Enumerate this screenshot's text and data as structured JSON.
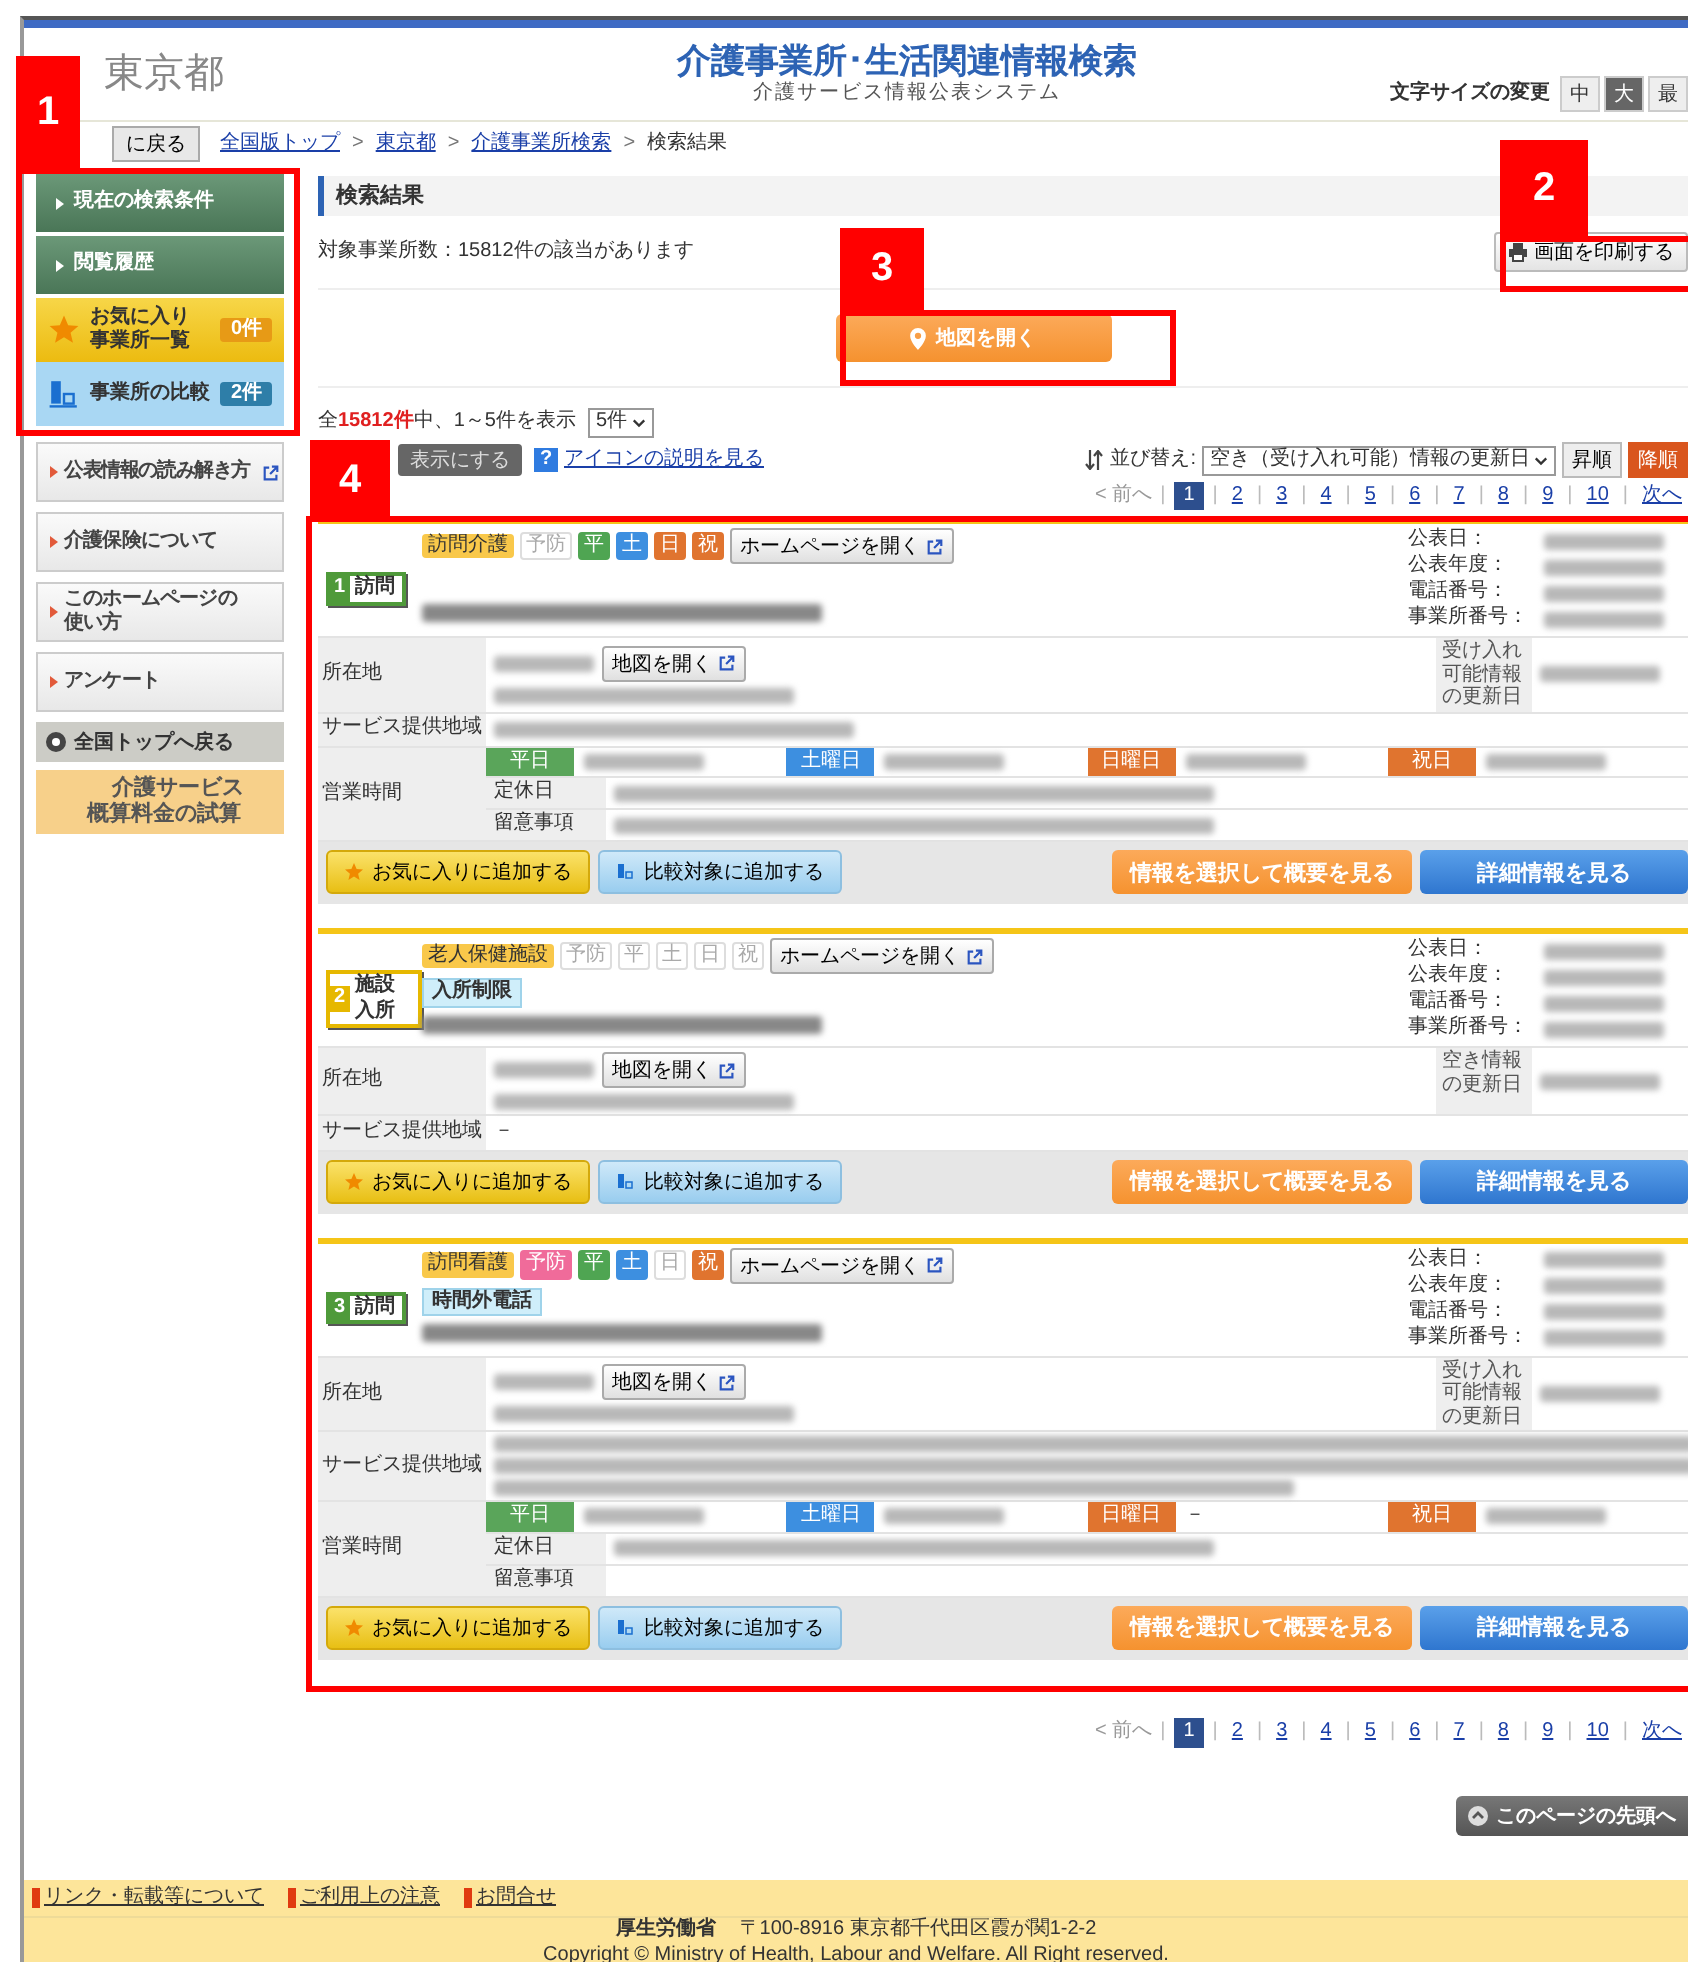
{
  "annotations": [
    {
      "label": "1"
    },
    {
      "label": "2"
    },
    {
      "label": "3"
    },
    {
      "label": "4"
    }
  ],
  "header": {
    "logo": "東京都",
    "title": "介護事業所･生活関連情報検索",
    "subtitle": "介護サービス情報公表システム",
    "font_size_label": "文字サイズの変更",
    "font_sizes": [
      {
        "label": "中",
        "selected": false
      },
      {
        "label": "大",
        "selected": true
      },
      {
        "label": "最",
        "selected": false
      }
    ]
  },
  "breadcrumb": {
    "back_button": "に戻る",
    "separator": ">",
    "links": [
      "全国版トップ",
      "東京都",
      "介護事業所検索"
    ],
    "current": "検索結果"
  },
  "sidebar": {
    "menu": [
      {
        "kind": "green",
        "label": "現在の検索条件"
      },
      {
        "kind": "green",
        "label": "閲覧履歴"
      },
      {
        "kind": "favorite",
        "label": "お気に入り事業所一覧",
        "count": "0件"
      },
      {
        "kind": "compare",
        "label": "事業所の比較",
        "count": "2件"
      }
    ],
    "links": [
      {
        "label": "公表情報の読み解き方",
        "external": true
      },
      {
        "label": "介護保険について",
        "external": false
      },
      {
        "label": "このホームページの使い方",
        "external": false
      },
      {
        "label": "アンケート",
        "external": false
      }
    ],
    "back_button": "全国トップへ戻る",
    "estimate_button": "介護サービス概算料金の試算"
  },
  "results": {
    "heading": "検索結果",
    "summary": "対象事業所数：15812件の該当があります",
    "print_button": "画面を印刷する",
    "map_button": "地図を開く",
    "count_prefix": "全",
    "count_total": "15812件",
    "count_suffix": "中、1～5件を表示",
    "per_page": "5件",
    "toggle_button": "表示にする",
    "help_icon": "?",
    "help_link": "アイコンの説明を見る",
    "sort_label": "並び替え:",
    "sort_value": "空き（受け入れ可能）情報の更新日",
    "sort_buttons": [
      {
        "label": "昇順",
        "selected": false
      },
      {
        "label": "降順",
        "selected": true
      }
    ]
  },
  "pager_top": {
    "prev": "< 前へ",
    "separator": "|",
    "pages": [
      {
        "label": "1",
        "selected": true
      },
      {
        "label": "2",
        "selected": false
      },
      {
        "label": "3",
        "selected": false
      },
      {
        "label": "4",
        "selected": false
      },
      {
        "label": "5",
        "selected": false
      },
      {
        "label": "6",
        "selected": false
      },
      {
        "label": "7",
        "selected": false
      },
      {
        "label": "8",
        "selected": false
      },
      {
        "label": "9",
        "selected": false
      },
      {
        "label": "10",
        "selected": false
      }
    ],
    "next": "次へ"
  },
  "cards": [
    {
      "kind": "visit",
      "number": "1",
      "category": "訪問",
      "service": "訪問介護",
      "tags": [
        {
          "label": "予防",
          "on": false
        },
        {
          "label": "平",
          "on": true,
          "color": "#4fa552"
        },
        {
          "label": "土",
          "on": true,
          "color": "#3d8fe0"
        },
        {
          "label": "日",
          "on": true,
          "color": "#e0742f"
        },
        {
          "label": "祝",
          "on": true,
          "color": "#e0742f"
        }
      ],
      "homepage_button": "ホームページを開く",
      "info_labels": [
        "公表日：",
        "公表年度：",
        "電話番号：",
        "事業所番号："
      ],
      "location": {
        "label": "所在地",
        "map_button": "地図を開く",
        "side_label": "受け入れ可能情報の更新日"
      },
      "area": {
        "label": "サービス提供地域",
        "kind": "short"
      },
      "hours": {
        "label": "営業時間",
        "days": [
          {
            "label": "平日",
            "kind": "weekday"
          },
          {
            "label": "土曜日",
            "kind": "saturday"
          },
          {
            "label": "日曜日",
            "kind": "sunday"
          },
          {
            "label": "祝日",
            "kind": "holiday"
          }
        ],
        "rows": [
          {
            "label": "定休日",
            "kind": "redacted"
          },
          {
            "label": "留意事項",
            "kind": "redacted"
          }
        ]
      },
      "buttons": {
        "favorite": "お気に入りに追加する",
        "compare": "比較対象に追加する",
        "overview": "情報を選択して概要を見る",
        "detail": "詳細情報を見る"
      }
    },
    {
      "kind": "facility",
      "number": "2",
      "category": "施設入所",
      "service": "老人保健施設",
      "tags": [
        {
          "label": "予防",
          "on": false
        },
        {
          "label": "平",
          "on": false
        },
        {
          "label": "土",
          "on": false
        },
        {
          "label": "日",
          "on": false
        },
        {
          "label": "祝",
          "on": false
        }
      ],
      "homepage_button": "ホームページを開く",
      "feature": "入所制限",
      "info_labels": [
        "公表日：",
        "公表年度：",
        "電話番号：",
        "事業所番号："
      ],
      "location": {
        "label": "所在地",
        "map_button": "地図を開く",
        "side_label": "空き情報の更新日"
      },
      "area": {
        "label": "サービス提供地域",
        "kind": "text",
        "value": "－"
      },
      "buttons": {
        "favorite": "お気に入りに追加する",
        "compare": "比較対象に追加する",
        "overview": "情報を選択して概要を見る",
        "detail": "詳細情報を見る"
      }
    },
    {
      "kind": "visit",
      "number": "3",
      "category": "訪問",
      "service": "訪問看護",
      "tags": [
        {
          "label": "予防",
          "on": true,
          "color": "#f06b9a"
        },
        {
          "label": "平",
          "on": true,
          "color": "#4fa552"
        },
        {
          "label": "土",
          "on": true,
          "color": "#3d8fe0"
        },
        {
          "label": "日",
          "on": false
        },
        {
          "label": "祝",
          "on": true,
          "color": "#e0742f"
        }
      ],
      "homepage_button": "ホームページを開く",
      "feature": "時間外電話",
      "info_labels": [
        "公表日：",
        "公表年度：",
        "電話番号：",
        "事業所番号："
      ],
      "location": {
        "label": "所在地",
        "map_button": "地図を開く",
        "side_label": "受け入れ可能情報の更新日"
      },
      "area": {
        "label": "サービス提供地域",
        "kind": "long"
      },
      "hours": {
        "label": "営業時間",
        "days": [
          {
            "label": "平日",
            "kind": "weekday"
          },
          {
            "label": "土曜日",
            "kind": "saturday"
          },
          {
            "label": "日曜日",
            "kind": "sunday",
            "value": "－"
          },
          {
            "label": "祝日",
            "kind": "holiday"
          }
        ],
        "rows": [
          {
            "label": "定休日",
            "kind": "redacted"
          },
          {
            "label": "留意事項",
            "kind": "empty"
          }
        ]
      },
      "buttons": {
        "favorite": "お気に入りに追加する",
        "compare": "比較対象に追加する",
        "overview": "情報を選択して概要を見る",
        "detail": "詳細情報を見る"
      }
    }
  ],
  "pager_bottom": {
    "prev": "< 前へ",
    "separator": "|",
    "pages": [
      {
        "label": "1",
        "selected": true
      },
      {
        "label": "2",
        "selected": false
      },
      {
        "label": "3",
        "selected": false
      },
      {
        "label": "4",
        "selected": false
      },
      {
        "label": "5",
        "selected": false
      },
      {
        "label": "6",
        "selected": false
      },
      {
        "label": "7",
        "selected": false
      },
      {
        "label": "8",
        "selected": false
      },
      {
        "label": "9",
        "selected": false
      },
      {
        "label": "10",
        "selected": false
      }
    ],
    "next": "次へ"
  },
  "page_top_button": "このページの先頭へ",
  "footer": {
    "links": [
      "リンク・転載等について",
      "ご利用上の注意",
      "お問合せ"
    ],
    "org": "厚生労働省",
    "address": "〒100-8916 東京都千代田区霞が関1-2-2",
    "copyright": "Copyright © Ministry of Health, Labour and Welfare. All Right reserved."
  }
}
